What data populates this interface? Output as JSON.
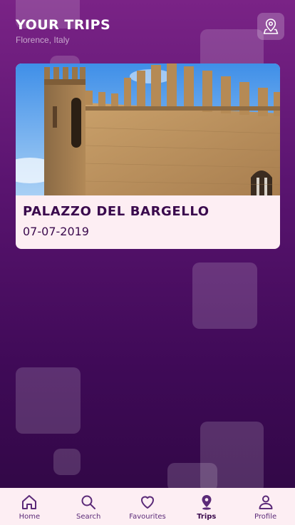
{
  "header": {
    "title": "YOUR TRIPS",
    "subtitle": "Florence, Italy"
  },
  "map_button": {
    "icon": "map-pin-icon"
  },
  "trips": [
    {
      "name": "PALAZZO DEL BARGELLO",
      "date": "07-07-2019",
      "image": "palazzo-del-bargello-photo"
    }
  ],
  "tabbar": {
    "active": "Trips",
    "items": [
      {
        "label": "Home",
        "icon": "home-icon"
      },
      {
        "label": "Search",
        "icon": "search-icon"
      },
      {
        "label": "Favourites",
        "icon": "heart-icon"
      },
      {
        "label": "Trips",
        "icon": "map-pin-icon"
      },
      {
        "label": "Profile",
        "icon": "user-icon"
      }
    ]
  },
  "colors": {
    "background_top": "#7a2386",
    "background_bottom": "#2e0742",
    "card": "#fdeef3",
    "text_dark": "#3a0a4d",
    "tab_icon": "#5b2a78"
  }
}
